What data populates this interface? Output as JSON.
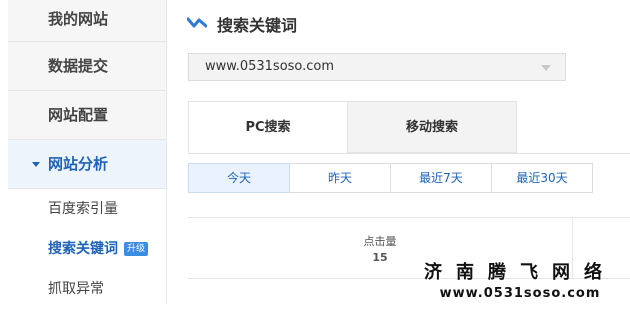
{
  "sidebar": {
    "items": [
      {
        "label": "我的网站"
      },
      {
        "label": "数据提交"
      },
      {
        "label": "网站配置"
      },
      {
        "label": "网站分析"
      }
    ],
    "sub_items": [
      {
        "label": "百度索引量"
      },
      {
        "label": "搜索关键词",
        "badge": "升级"
      },
      {
        "label": "抓取异常"
      }
    ]
  },
  "main": {
    "title": "搜索关键词",
    "site_select": {
      "value": "www.0531soso.com"
    },
    "tabs": [
      {
        "label": "PC搜索"
      },
      {
        "label": "移动搜索"
      }
    ],
    "ranges": [
      {
        "label": "今天"
      },
      {
        "label": "昨天"
      },
      {
        "label": "最近7天"
      },
      {
        "label": "最近30天"
      }
    ],
    "stats": {
      "label": "点击量",
      "value": "15"
    }
  },
  "watermark": {
    "name": "济南腾飞网络",
    "url": "www.0531soso.com"
  },
  "colors": {
    "accent": "#1f63b6",
    "badge": "#3a8de0",
    "active_bg": "#eef4fb"
  }
}
